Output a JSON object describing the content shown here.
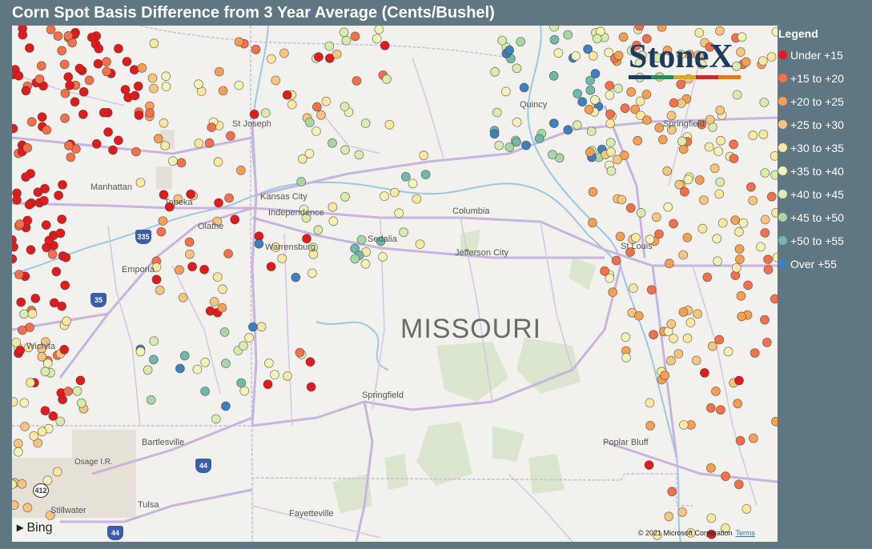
{
  "title": "Corn Spot Basis Difference from 3 Year Average (Cents/Bushel)",
  "state_label": "MISSOURI",
  "logo": "StoneX",
  "logo_colors": [
    "#1e3a5f",
    "#2a8a5a",
    "#d4a92a",
    "#c03030",
    "#e07a20"
  ],
  "bing": "Bing",
  "copyright": "© 2021 Microsoft Corporation",
  "terms": "Terms",
  "legend": {
    "title": "Legend",
    "items": [
      {
        "label": "Under +15",
        "color": "#e31a1c"
      },
      {
        "label": "+15 to +20",
        "color": "#f4704a"
      },
      {
        "label": "+20 to +25",
        "color": "#f79e52"
      },
      {
        "label": "+25 to +30",
        "color": "#f8c57d"
      },
      {
        "label": "+30 to +35",
        "color": "#fbe8a0"
      },
      {
        "label": "+35 to +40",
        "color": "#f4f3b7"
      },
      {
        "label": "+40 to +45",
        "color": "#d8ecad"
      },
      {
        "label": "+45 to +50",
        "color": "#a9d7a3"
      },
      {
        "label": "+50 to +55",
        "color": "#6fb8aa"
      },
      {
        "label": "Over +55",
        "color": "#3d7fbf"
      }
    ]
  },
  "cities": [
    "St Joseph",
    "Quincy",
    "Springfield",
    "Manhattan",
    "Topeka",
    "Kansas City",
    "Independence",
    "Olathe",
    "Columbia",
    "Sedalia",
    "Warrensburg",
    "Jefferson City",
    "St Louis",
    "Emporia",
    "Wichita",
    "Springfield",
    "Bartlesville",
    "Osage I.R.",
    "Poplar Bluff",
    "Stillwater",
    "Tulsa",
    "Fayetteville"
  ],
  "shields": [
    "335",
    "35",
    "44",
    "412",
    "44"
  ]
}
